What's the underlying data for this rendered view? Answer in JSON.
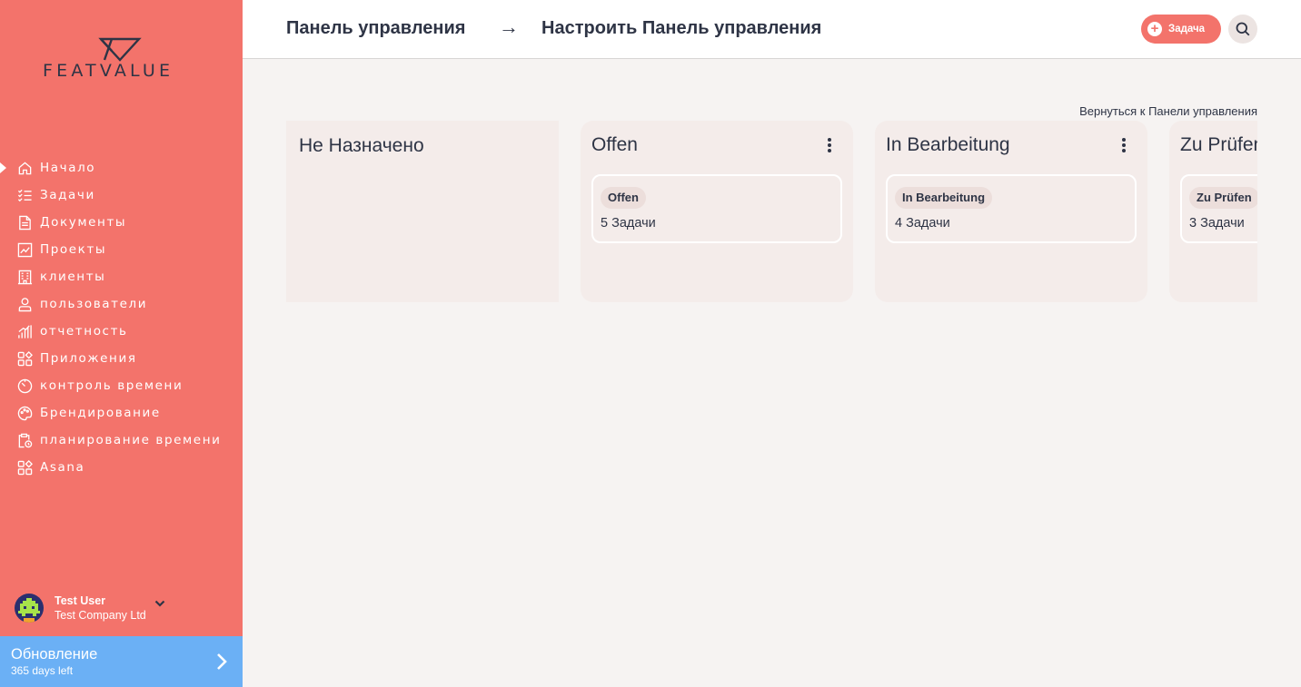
{
  "brand": {
    "name": "FEATVALUE"
  },
  "sidebar": {
    "items": [
      {
        "label": "Начало",
        "icon": "home-icon",
        "active": true
      },
      {
        "label": "Задачи",
        "icon": "checklist-icon"
      },
      {
        "label": "Документы",
        "icon": "document-icon"
      },
      {
        "label": "Проекты",
        "icon": "chart-board-icon"
      },
      {
        "label": "клиенты",
        "icon": "building-icon"
      },
      {
        "label": "пользователи",
        "icon": "user-icon"
      },
      {
        "label": "отчетность",
        "icon": "bar-chart-icon"
      },
      {
        "label": "Приложения",
        "icon": "apps-icon"
      },
      {
        "label": "контроль времени",
        "icon": "timer-icon"
      },
      {
        "label": "Брендирование",
        "icon": "palette-icon"
      },
      {
        "label": "планирование времени",
        "icon": "clipboard-clock-icon"
      },
      {
        "label": "Asana",
        "icon": "apps-icon"
      }
    ],
    "user": {
      "name": "Test User",
      "company": "Test Company Ltd"
    },
    "upgrade": {
      "title": "Обновление",
      "subtitle": "365 days left"
    }
  },
  "header": {
    "crumb_1": "Панель управления",
    "crumb_arrow": "→",
    "crumb_2": "Настроить Панель управления",
    "task_button": "Задача"
  },
  "main": {
    "back_link": "Вернуться к Панели управления",
    "columns": [
      {
        "title": "Не Назначено"
      },
      {
        "title": "Offen",
        "badge": "Offen",
        "count": "5 Задачи"
      },
      {
        "title": "In Bearbeitung",
        "badge": "In Bearbeitung",
        "count": "4 Задачи"
      },
      {
        "title": "Zu Prüfen",
        "badge": "Zu Prüfen",
        "count": "3 Задачи"
      }
    ]
  },
  "colors": {
    "sidebar": "#f3736b",
    "upgrade": "#6bb0f5",
    "text": "#2e3445",
    "column": "#f4ecea"
  }
}
